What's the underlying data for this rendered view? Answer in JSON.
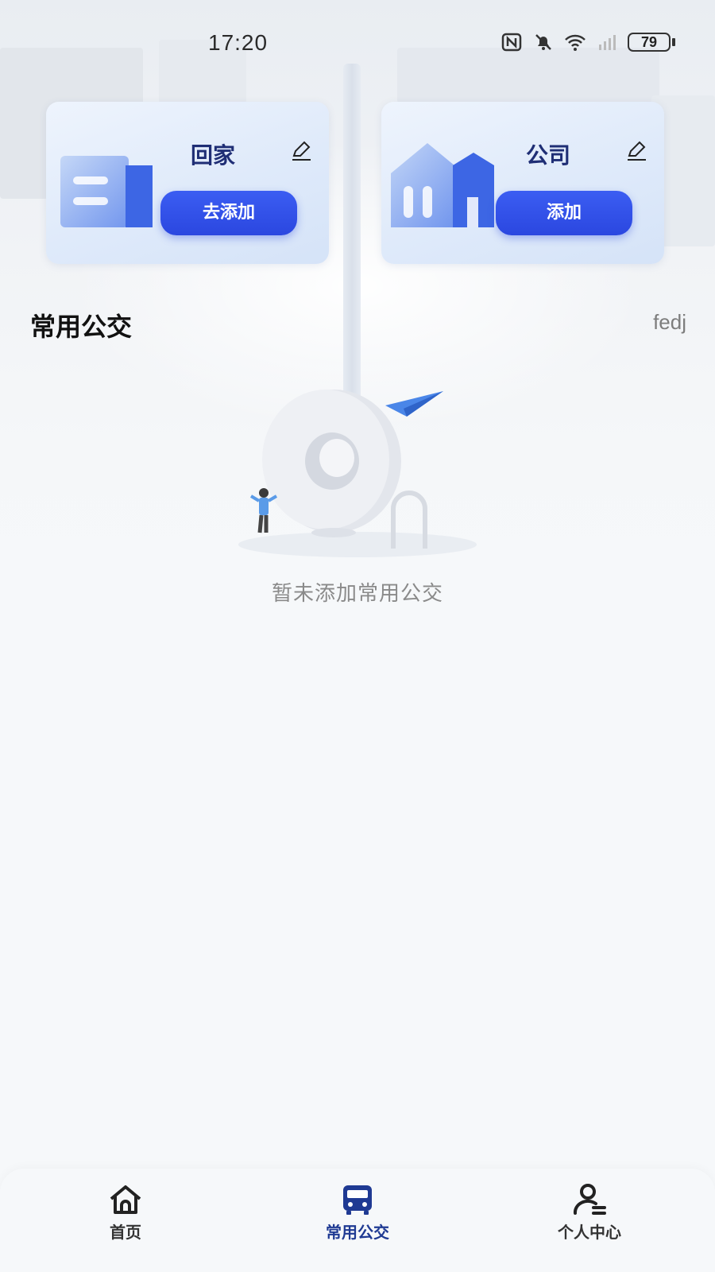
{
  "status_bar": {
    "time": "17:20",
    "battery": "79"
  },
  "quick_places": [
    {
      "title": "回家",
      "button_label": "去添加"
    },
    {
      "title": "公司",
      "button_label": "添加"
    }
  ],
  "section": {
    "title": "常用公交",
    "right_text": "fedj"
  },
  "empty_state": {
    "message": "暂未添加常用公交"
  },
  "bottom_nav": {
    "items": [
      {
        "label": "首页",
        "icon": "home-icon",
        "active": false
      },
      {
        "label": "常用公交",
        "icon": "bus-icon",
        "active": true
      },
      {
        "label": "个人中心",
        "icon": "user-icon",
        "active": false
      }
    ]
  },
  "colors": {
    "accent": "#2f4fe6",
    "title_blue": "#1f2e75",
    "active_nav": "#1f3a93",
    "background": "#f6f8fa"
  }
}
